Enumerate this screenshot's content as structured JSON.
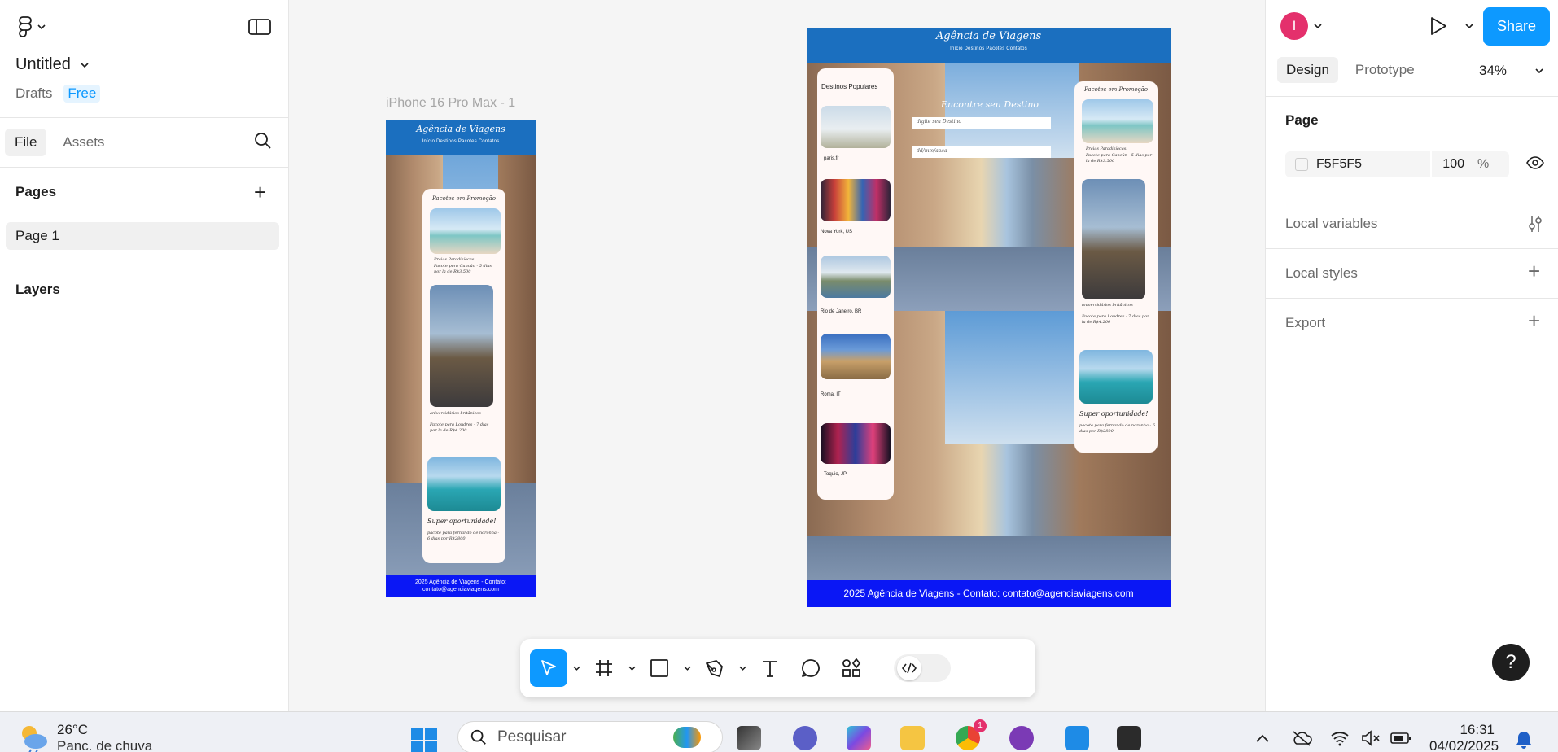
{
  "left_panel": {
    "file_title": "Untitled",
    "location": "Drafts",
    "plan_badge": "Free",
    "tabs": [
      {
        "label": "File"
      },
      {
        "label": "Assets"
      }
    ],
    "pages_title": "Pages",
    "pages": [
      {
        "label": "Page 1"
      }
    ],
    "layers_title": "Layers"
  },
  "canvas": {
    "frame_label": "iPhone 16 Pro Max - 1",
    "site_title": "Agência de Viagens",
    "site_nav": "Início  Destinos  Pacotes  Contatos",
    "mobile_footer": "2025 Agência de Viagens - Contato: contato@agenciaviagens.com",
    "desktop_footer": "2025 Agência de Viagens - Contato: contato@agenciaviagens.com",
    "promo_title": "Pacotes em Promoção",
    "promos": [
      {
        "title": "Praias Paradisíacas!",
        "desc": "Pacote para Cancún - 5 dias por la de R$3.500"
      },
      {
        "title": "aniversidários britânicos",
        "desc": "Pacote para Londres - 7 dias por la de R$4.200"
      },
      {
        "title": "Super oportunidade!",
        "desc": "pacote para fernando de noronha - 6 dias por R$2800"
      }
    ],
    "popular_title": "Destinos Populares",
    "destinations": [
      {
        "label": "paris,fr"
      },
      {
        "label": "Nova York, US"
      },
      {
        "label": "Rio de Janeiro, BR"
      },
      {
        "label": "Roma, IT"
      },
      {
        "label": "Toquio, JP"
      }
    ],
    "hero_title": "Encontre seu Destino",
    "search_fields": [
      "digite seu Destino",
      "dd/mm/aaaa"
    ]
  },
  "toolbar": {
    "tools": [
      "move-tool",
      "frame-tool",
      "shape-tool",
      "pen-tool",
      "text-tool",
      "comment-tool",
      "actions-tool",
      "dev-mode-toggle"
    ]
  },
  "right_panel": {
    "avatar_initial": "I",
    "share_label": "Share",
    "tabs": [
      {
        "label": "Design"
      },
      {
        "label": "Prototype"
      }
    ],
    "zoom": "34%",
    "page_section": "Page",
    "page_color_hex": "F5F5F5",
    "page_opacity": "100",
    "page_opacity_unit": "%",
    "local_variables": "Local variables",
    "local_styles": "Local styles",
    "export": "Export",
    "help_label": "?"
  },
  "taskbar": {
    "temperature": "26°C",
    "weather_condition": "Panc. de chuva",
    "search_placeholder": "Pesquisar",
    "time": "16:31",
    "date": "04/02/2025",
    "chrome_badge": "1"
  },
  "colors": {
    "accent": "#0d99ff",
    "site_header": "#1b6fbf",
    "site_footer": "#0a17f5",
    "avatar": "#e4306c"
  }
}
